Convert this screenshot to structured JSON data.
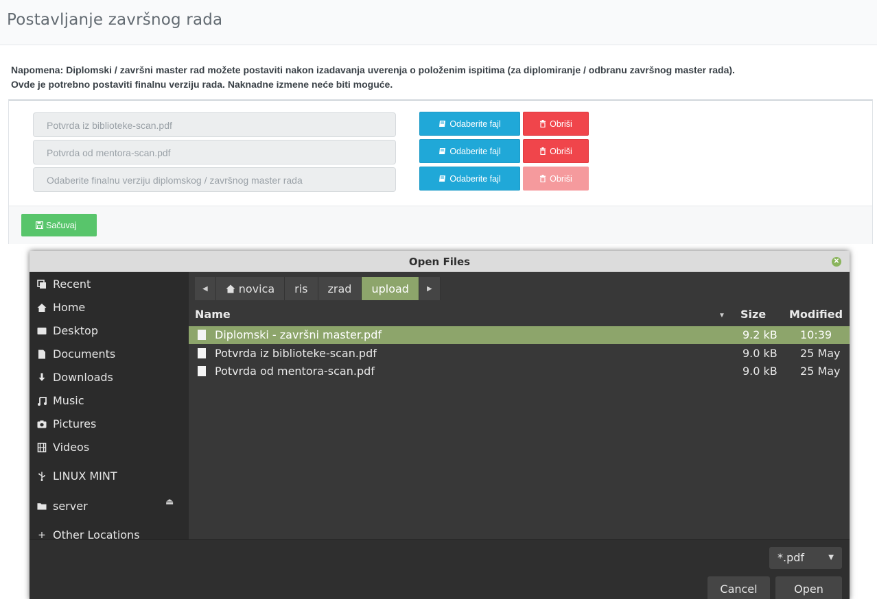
{
  "page": {
    "title": "Postavljanje završnog rada",
    "note_line1": "Napomena: Diplomski / završni master rad možete postaviti nakon izadavanja uverenja o položenim ispitima (za diplomiranje / odbranu završnog master rada).",
    "note_line2": "Ovde je potrebno postaviti finalnu verziju rada. Naknadne izmene neće biti moguće.",
    "file_fields": [
      {
        "value": "Potvrda iz biblioteke-scan.pdf",
        "delete_enabled": true
      },
      {
        "value": "Potvrda od mentora-scan.pdf",
        "delete_enabled": true
      },
      {
        "value": "Odaberite finalnu verziju diplomskog / završnog master rada",
        "delete_enabled": false
      }
    ],
    "choose_label": "Odaberite fajl",
    "delete_label": "Obriši",
    "save_label": "Sačuvaj",
    "colors": {
      "choose": "#20a8d8",
      "delete": "#f0454b",
      "save": "#58c56b"
    }
  },
  "dialog": {
    "title": "Open Files",
    "places": [
      {
        "label": "Recent",
        "icon": "recent-icon"
      },
      {
        "label": "Home",
        "icon": "home-icon"
      },
      {
        "label": "Desktop",
        "icon": "desktop-icon"
      },
      {
        "label": "Documents",
        "icon": "documents-icon"
      },
      {
        "label": "Downloads",
        "icon": "downloads-icon"
      },
      {
        "label": "Music",
        "icon": "music-icon"
      },
      {
        "label": "Pictures",
        "icon": "pictures-icon"
      },
      {
        "label": "Videos",
        "icon": "videos-icon"
      },
      {
        "label": "LINUX MINT",
        "icon": "usb-icon"
      },
      {
        "label": "server",
        "icon": "network-folder-icon"
      },
      {
        "label": "Other Locations",
        "icon": "plus-icon"
      }
    ],
    "path": [
      "novica",
      "ris",
      "zrad",
      "upload"
    ],
    "columns": {
      "name": "Name",
      "size": "Size",
      "modified": "Modified"
    },
    "files": [
      {
        "name": "Diplomski - završni master.pdf",
        "size": "9.2 kB",
        "modified": "10:39",
        "selected": true
      },
      {
        "name": "Potvrda iz biblioteke-scan.pdf",
        "size": "9.0 kB",
        "modified": "25 May",
        "selected": false
      },
      {
        "name": "Potvrda od mentora-scan.pdf",
        "size": "9.0 kB",
        "modified": "25 May",
        "selected": false
      }
    ],
    "filter": "*.pdf",
    "cancel_label": "Cancel",
    "open_label": "Open",
    "accent": "#8da56b"
  }
}
